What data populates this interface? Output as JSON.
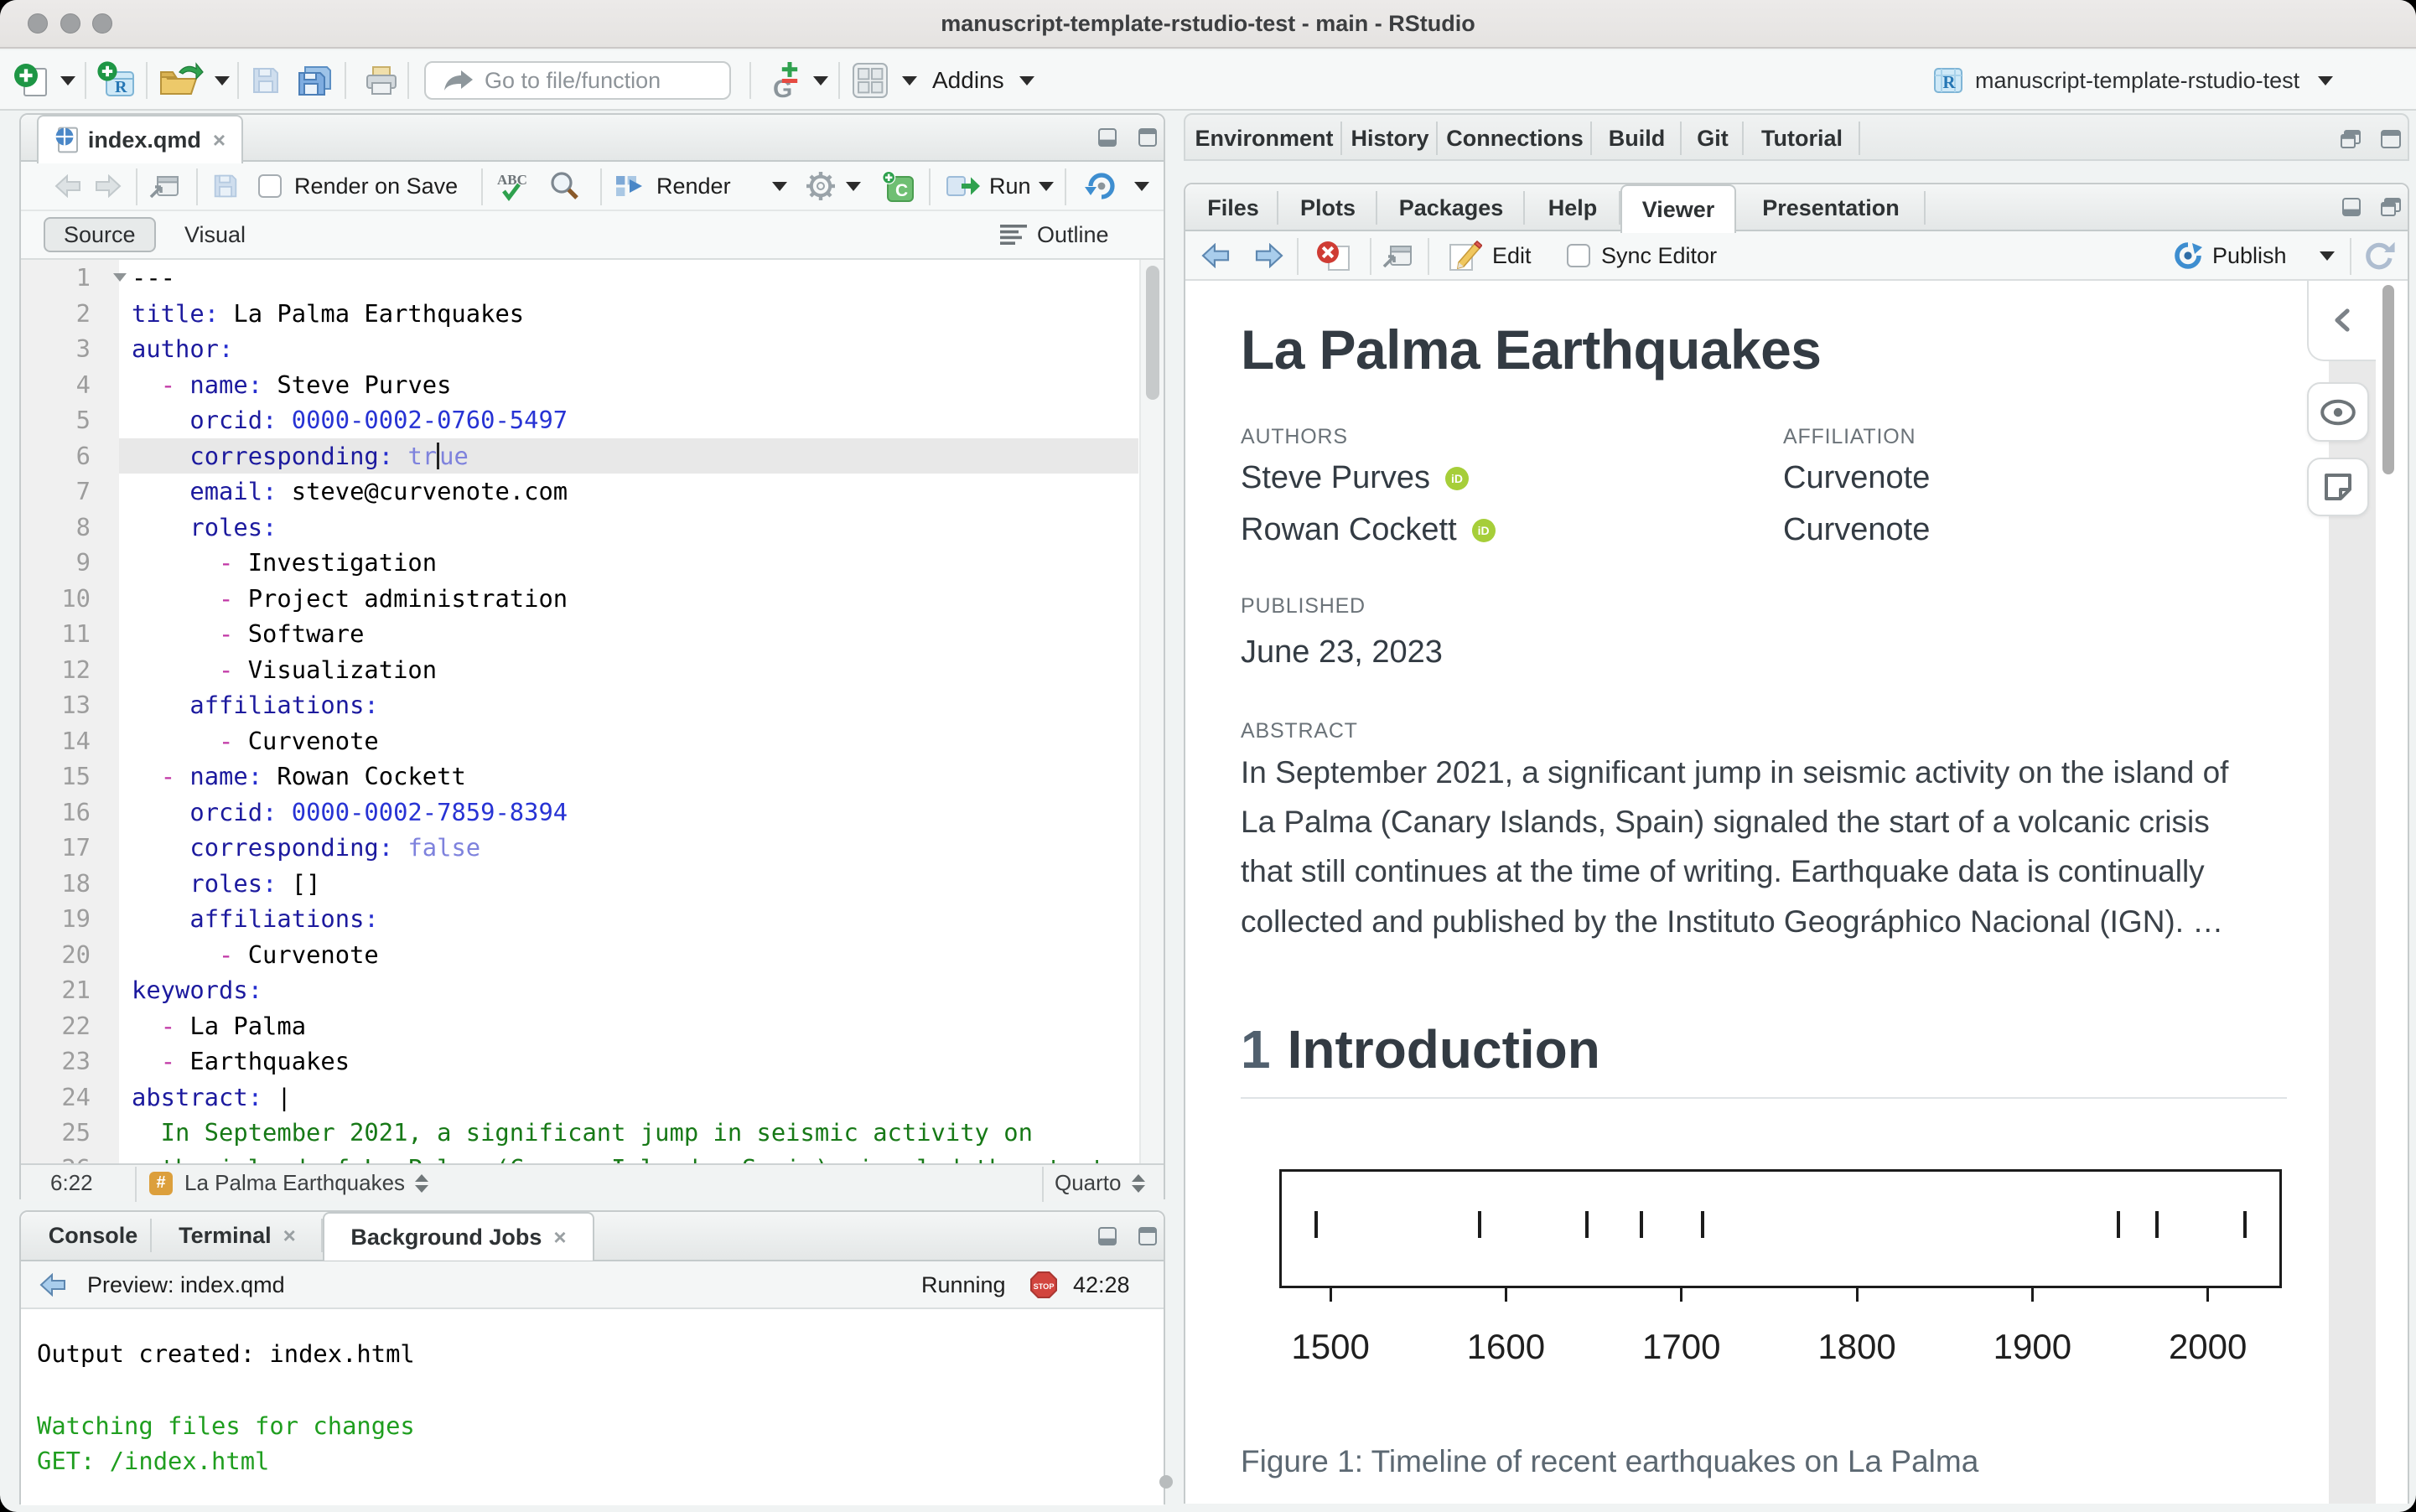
{
  "window": {
    "title": "manuscript-template-rstudio-test - main - RStudio",
    "project": "manuscript-template-rstudio-test"
  },
  "main_toolbar": {
    "goto_placeholder": "Go to file/function",
    "addins_label": "Addins"
  },
  "editor": {
    "tab": "index.qmd",
    "toolbar": {
      "render_on_save": "Render on Save",
      "render": "Render",
      "run": "Run"
    },
    "mode_tabs": {
      "source": "Source",
      "visual": "Visual",
      "outline": "Outline"
    },
    "current_line": 6,
    "code_lines": [
      {
        "n": 1,
        "fold": true,
        "segs": [
          [
            "---",
            "v"
          ]
        ]
      },
      {
        "n": 2,
        "segs": [
          [
            "title",
            "k"
          ],
          [
            ":",
            "p"
          ],
          [
            " La Palma Earthquakes",
            "v"
          ]
        ]
      },
      {
        "n": 3,
        "segs": [
          [
            "author",
            "k"
          ],
          [
            ":",
            "p"
          ]
        ]
      },
      {
        "n": 4,
        "segs": [
          [
            "  ",
            "v"
          ],
          [
            "- ",
            "d"
          ],
          [
            "name",
            "k"
          ],
          [
            ":",
            "p"
          ],
          [
            " Steve Purves",
            "v"
          ]
        ]
      },
      {
        "n": 5,
        "segs": [
          [
            "    ",
            "v"
          ],
          [
            "orcid",
            "k"
          ],
          [
            ":",
            "p"
          ],
          [
            " ",
            "v"
          ],
          [
            "0000-0002-0760-5497",
            "n"
          ]
        ]
      },
      {
        "n": 6,
        "segs": [
          [
            "    ",
            "v"
          ],
          [
            "corresponding",
            "k"
          ],
          [
            ":",
            "p"
          ],
          [
            " ",
            "v"
          ],
          [
            "tr",
            "b"
          ],
          [
            "",
            "caret"
          ],
          [
            "ue",
            "b"
          ]
        ]
      },
      {
        "n": 7,
        "segs": [
          [
            "    ",
            "v"
          ],
          [
            "email",
            "k"
          ],
          [
            ":",
            "p"
          ],
          [
            " steve@curvenote.com",
            "v"
          ]
        ]
      },
      {
        "n": 8,
        "segs": [
          [
            "    ",
            "v"
          ],
          [
            "roles",
            "k"
          ],
          [
            ":",
            "p"
          ]
        ]
      },
      {
        "n": 9,
        "segs": [
          [
            "      ",
            "v"
          ],
          [
            "- ",
            "d"
          ],
          [
            "Investigation",
            "v"
          ]
        ]
      },
      {
        "n": 10,
        "segs": [
          [
            "      ",
            "v"
          ],
          [
            "- ",
            "d"
          ],
          [
            "Project administration",
            "v"
          ]
        ]
      },
      {
        "n": 11,
        "segs": [
          [
            "      ",
            "v"
          ],
          [
            "- ",
            "d"
          ],
          [
            "Software",
            "v"
          ]
        ]
      },
      {
        "n": 12,
        "segs": [
          [
            "      ",
            "v"
          ],
          [
            "- ",
            "d"
          ],
          [
            "Visualization",
            "v"
          ]
        ]
      },
      {
        "n": 13,
        "segs": [
          [
            "    ",
            "v"
          ],
          [
            "affiliations",
            "k"
          ],
          [
            ":",
            "p"
          ]
        ]
      },
      {
        "n": 14,
        "segs": [
          [
            "      ",
            "v"
          ],
          [
            "- ",
            "d"
          ],
          [
            "Curvenote",
            "v"
          ]
        ]
      },
      {
        "n": 15,
        "segs": [
          [
            "  ",
            "v"
          ],
          [
            "- ",
            "d"
          ],
          [
            "name",
            "k"
          ],
          [
            ":",
            "p"
          ],
          [
            " Rowan Cockett",
            "v"
          ]
        ]
      },
      {
        "n": 16,
        "segs": [
          [
            "    ",
            "v"
          ],
          [
            "orcid",
            "k"
          ],
          [
            ":",
            "p"
          ],
          [
            " ",
            "v"
          ],
          [
            "0000-0002-7859-8394",
            "n"
          ]
        ]
      },
      {
        "n": 17,
        "segs": [
          [
            "    ",
            "v"
          ],
          [
            "corresponding",
            "k"
          ],
          [
            ":",
            "p"
          ],
          [
            " ",
            "v"
          ],
          [
            "false",
            "b"
          ]
        ]
      },
      {
        "n": 18,
        "segs": [
          [
            "    ",
            "v"
          ],
          [
            "roles",
            "k"
          ],
          [
            ":",
            "p"
          ],
          [
            " []",
            "v"
          ]
        ]
      },
      {
        "n": 19,
        "segs": [
          [
            "    ",
            "v"
          ],
          [
            "affiliations",
            "k"
          ],
          [
            ":",
            "p"
          ]
        ]
      },
      {
        "n": 20,
        "segs": [
          [
            "      ",
            "v"
          ],
          [
            "- ",
            "d"
          ],
          [
            "Curvenote",
            "v"
          ]
        ]
      },
      {
        "n": 21,
        "segs": [
          [
            "keywords",
            "k"
          ],
          [
            ":",
            "p"
          ]
        ]
      },
      {
        "n": 22,
        "segs": [
          [
            "  ",
            "v"
          ],
          [
            "- ",
            "d"
          ],
          [
            "La Palma",
            "v"
          ]
        ]
      },
      {
        "n": 23,
        "segs": [
          [
            "  ",
            "v"
          ],
          [
            "- ",
            "d"
          ],
          [
            "Earthquakes",
            "v"
          ]
        ]
      },
      {
        "n": 24,
        "segs": [
          [
            "abstract",
            "k"
          ],
          [
            ":",
            "p"
          ],
          [
            " |",
            "v"
          ]
        ]
      },
      {
        "n": 25,
        "segs": [
          [
            "  In September 2021, a significant jump in seismic activity on",
            "s"
          ]
        ]
      },
      {
        "n": 26,
        "segs": [
          [
            "  the island of La Palma (Canary Islands, Spain) signaled the start",
            "s"
          ]
        ]
      }
    ],
    "status": {
      "position": "6:22",
      "section": "La Palma Earthquakes",
      "mode": "Quarto"
    }
  },
  "console": {
    "tabs": {
      "console": "Console",
      "terminal": "Terminal",
      "background_jobs": "Background Jobs"
    },
    "active_tab": "Background Jobs",
    "toolbar": {
      "title": "Preview: index.qmd",
      "status": "Running",
      "timer": "42:28",
      "stop_label": "STOP"
    },
    "lines": [
      {
        "text": "Output created: index.html",
        "color": "black"
      },
      {
        "text": "",
        "color": "black"
      },
      {
        "text": "Watching files for changes",
        "color": "green"
      },
      {
        "text": "GET: /index.html",
        "color": "green"
      }
    ]
  },
  "right_top_tabs": [
    "Environment",
    "History",
    "Connections",
    "Build",
    "Git",
    "Tutorial"
  ],
  "right_pane": {
    "tabs": [
      "Files",
      "Plots",
      "Packages",
      "Help",
      "Viewer",
      "Presentation"
    ],
    "active_tab": "Viewer",
    "toolbar": {
      "edit": "Edit",
      "sync": "Sync Editor",
      "publish": "Publish"
    }
  },
  "viewer": {
    "title": "La Palma Earthquakes",
    "authors_label": "AUTHORS",
    "affiliation_label": "AFFILIATION",
    "authors": [
      {
        "name": "Steve Purves",
        "orcid_icon": "orcid-icon",
        "affiliation": "Curvenote"
      },
      {
        "name": "Rowan Cockett",
        "orcid_icon": "orcid-icon",
        "affiliation": "Curvenote"
      }
    ],
    "published_label": "PUBLISHED",
    "published": "June 23, 2023",
    "abstract_label": "ABSTRACT",
    "abstract": "In September 2021, a significant jump in seismic activity on the island of La Palma (Canary Islands, Spain) signaled the start of a volcanic crisis that still continues at the time of writing. Earthquake data is continually collected and published by the Instituto Geográphico Nacional (IGN). …",
    "section_number": "1",
    "section_title": "Introduction",
    "figure_caption": "Figure 1: Timeline of recent earthquakes on La Palma"
  },
  "chart_data": {
    "type": "scatter",
    "title": "Timeline of recent earthquakes on La Palma",
    "x": [
      1492,
      1585,
      1646,
      1677,
      1712,
      1949,
      1971,
      2021
    ],
    "y": [
      0,
      0,
      0,
      0,
      0,
      0,
      0,
      0
    ],
    "marker": "|",
    "xticks": [
      1500,
      1600,
      1700,
      1800,
      1900,
      2000
    ],
    "xlim": [
      1470.8,
      2042.2
    ],
    "xlabel": "",
    "ylabel": "",
    "grid": false,
    "legend": false
  },
  "colors": {
    "accent_blue": "#2733d4",
    "key_navy": "#1c1a9e",
    "dash_magenta": "#c238a6",
    "bool_periwinkle": "#7e82dd",
    "string_green": "#177917",
    "console_green": "#1f9e1f",
    "orcid_green": "#a6ce39",
    "stop_red": "#cc3333"
  }
}
